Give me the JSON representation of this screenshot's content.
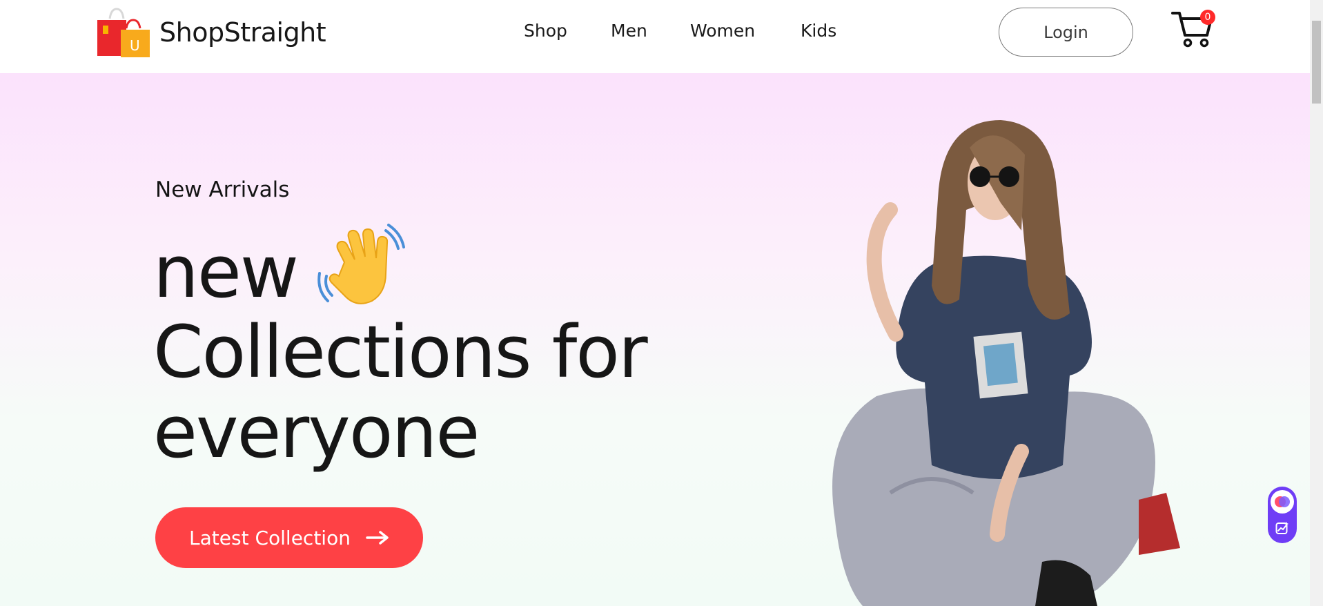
{
  "header": {
    "brand": "ShopStraight",
    "logo_icon": "shopping-bags-icon",
    "nav": [
      {
        "label": "Shop"
      },
      {
        "label": "Men"
      },
      {
        "label": "Women"
      },
      {
        "label": "Kids"
      }
    ],
    "login_label": "Login",
    "cart_icon": "cart-icon",
    "cart_count": "0"
  },
  "hero": {
    "eyebrow": "New Arrivals",
    "headline": [
      "new",
      "Collections for",
      "everyone"
    ],
    "emoji_icon": "waving-hand-icon",
    "cta_label": "Latest Collection",
    "cta_icon": "arrow-right-icon"
  },
  "colors": {
    "accent": "#fe4145",
    "badge": "#ff2a2a",
    "widget": "#6f3df6"
  }
}
